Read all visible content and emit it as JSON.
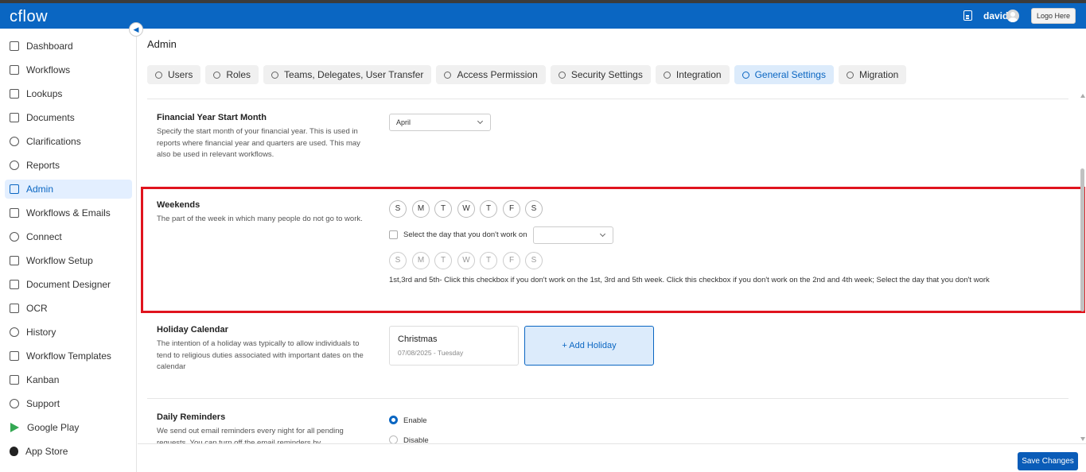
{
  "header": {
    "logo": "cflow",
    "username": "david",
    "logo_button": "Logo Here"
  },
  "sidebar": {
    "items": [
      {
        "label": "Dashboard",
        "icon": "dashboard-icon"
      },
      {
        "label": "Workflows",
        "icon": "workflows-icon"
      },
      {
        "label": "Lookups",
        "icon": "table-icon"
      },
      {
        "label": "Documents",
        "icon": "document-icon"
      },
      {
        "label": "Clarifications",
        "icon": "lightbulb-icon"
      },
      {
        "label": "Reports",
        "icon": "pie-chart-icon"
      },
      {
        "label": "Admin",
        "icon": "admin-icon",
        "active": true
      },
      {
        "label": "Workflows & Emails",
        "icon": "mail-icon"
      },
      {
        "label": "Connect",
        "icon": "connect-icon"
      },
      {
        "label": "Workflow Setup",
        "icon": "sliders-icon"
      },
      {
        "label": "Document Designer",
        "icon": "edit-document-icon"
      },
      {
        "label": "OCR",
        "icon": "scan-icon"
      },
      {
        "label": "History",
        "icon": "history-icon"
      },
      {
        "label": "Workflow Templates",
        "icon": "template-icon"
      },
      {
        "label": "Kanban",
        "icon": "kanban-icon"
      },
      {
        "label": "Support",
        "icon": "headset-icon"
      },
      {
        "label": "Google Play",
        "icon": "google-play-icon"
      },
      {
        "label": "App Store",
        "icon": "apple-icon"
      }
    ]
  },
  "page": {
    "title": "Admin"
  },
  "tabs": [
    {
      "label": "Users"
    },
    {
      "label": "Roles"
    },
    {
      "label": "Teams, Delegates, User Transfer"
    },
    {
      "label": "Access Permission"
    },
    {
      "label": "Security Settings"
    },
    {
      "label": "Integration"
    },
    {
      "label": "General Settings",
      "active": true
    },
    {
      "label": "Migration"
    }
  ],
  "financial_year": {
    "title": "Financial Year Start Month",
    "description": "Specify the start month of your financial year. This is used in reports where financial year and quarters are used. This may also be used in relevant workflows.",
    "value": "April"
  },
  "weekends": {
    "title": "Weekends",
    "description": "The part of the week in which many people do not go to work.",
    "days": [
      "S",
      "M",
      "T",
      "W",
      "T",
      "F",
      "S"
    ],
    "checkbox_label": "Select the day that you don't work on",
    "select_value": "",
    "days_secondary": [
      "S",
      "M",
      "T",
      "W",
      "T",
      "F",
      "S"
    ],
    "help_text": "1st,3rd and 5th- Click this checkbox if you don't work on the 1st, 3rd and 5th week. Click this checkbox if you don't work on the 2nd and 4th week; Select the day that you don't work"
  },
  "holiday": {
    "title": "Holiday Calendar",
    "description": "The intention of a holiday was typically to allow individuals to tend to religious duties associated with important dates on the calendar",
    "items": [
      {
        "name": "Christmas",
        "date": "07/08/2025 - Tuesday"
      }
    ],
    "add_label": "+ Add Holiday"
  },
  "reminders": {
    "title": "Daily Reminders",
    "description": "We send out email reminders every night for all pending requests. You can turn off the email reminders by",
    "options": [
      "Enable",
      "Disable"
    ],
    "selected": "Enable"
  },
  "footer": {
    "save_label": "Save Changes"
  },
  "colors": {
    "brand": "#0a66c2",
    "highlight": "#e0141e"
  }
}
